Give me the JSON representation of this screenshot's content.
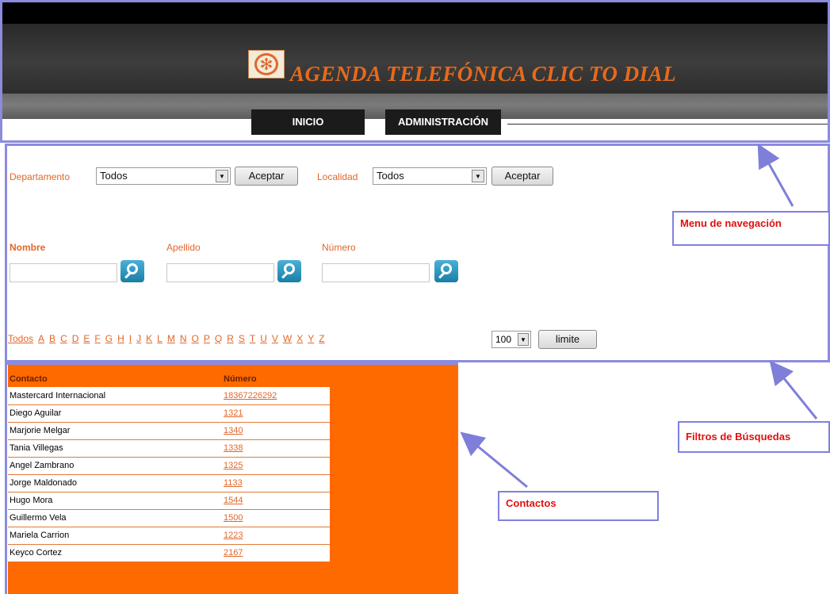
{
  "header": {
    "title": "AGENDA TELEFÓNICA CLIC TO DIAL",
    "logo_glyph": "✻"
  },
  "nav": {
    "tabs": [
      {
        "label": "INICIO"
      },
      {
        "label": "ADMINISTRACIÓN"
      }
    ]
  },
  "filters": {
    "departamento_label": "Departamento",
    "departamento_value": "Todos",
    "localidad_label": "Localidad",
    "localidad_value": "Todos",
    "accept_label": "Aceptar",
    "nombre_label": "Nombre",
    "apellido_label": "Apellido",
    "numero_label": "Número",
    "letters": [
      "Todos",
      "A",
      "B",
      "C",
      "D",
      "E",
      "F",
      "G",
      "H",
      "I",
      "J",
      "K",
      "L",
      "M",
      "N",
      "O",
      "P",
      "Q",
      "R",
      "S",
      "T",
      "U",
      "V",
      "W",
      "X",
      "Y",
      "Z"
    ],
    "limit_value": "100",
    "limit_button": "limite"
  },
  "contacts": {
    "headers": {
      "contact": "Contacto",
      "number": "Número"
    },
    "rows": [
      {
        "name": "Mastercard Internacional",
        "number": "18367226292"
      },
      {
        "name": "Diego Aguilar",
        "number": "1321"
      },
      {
        "name": "Marjorie Melgar",
        "number": "1340"
      },
      {
        "name": "Tania Villegas",
        "number": "1338"
      },
      {
        "name": "Angel Zambrano",
        "number": "1325"
      },
      {
        "name": "Jorge Maldonado",
        "number": "1133"
      },
      {
        "name": "Hugo Mora",
        "number": "1544"
      },
      {
        "name": "Guillermo Vela",
        "number": "1500"
      },
      {
        "name": "Mariela Carrion",
        "number": "1223"
      },
      {
        "name": "Keyco Cortez",
        "number": "2167"
      }
    ]
  },
  "annotations": {
    "menu": "Menu de navegación",
    "filters": "Filtros de Búsquedas",
    "contacts": "Contactos"
  },
  "colors": {
    "accent_orange": "#e2662a",
    "panel_orange": "#ff6a00",
    "frame_blue": "#8b8be0",
    "annotation_red": "#e01010"
  }
}
